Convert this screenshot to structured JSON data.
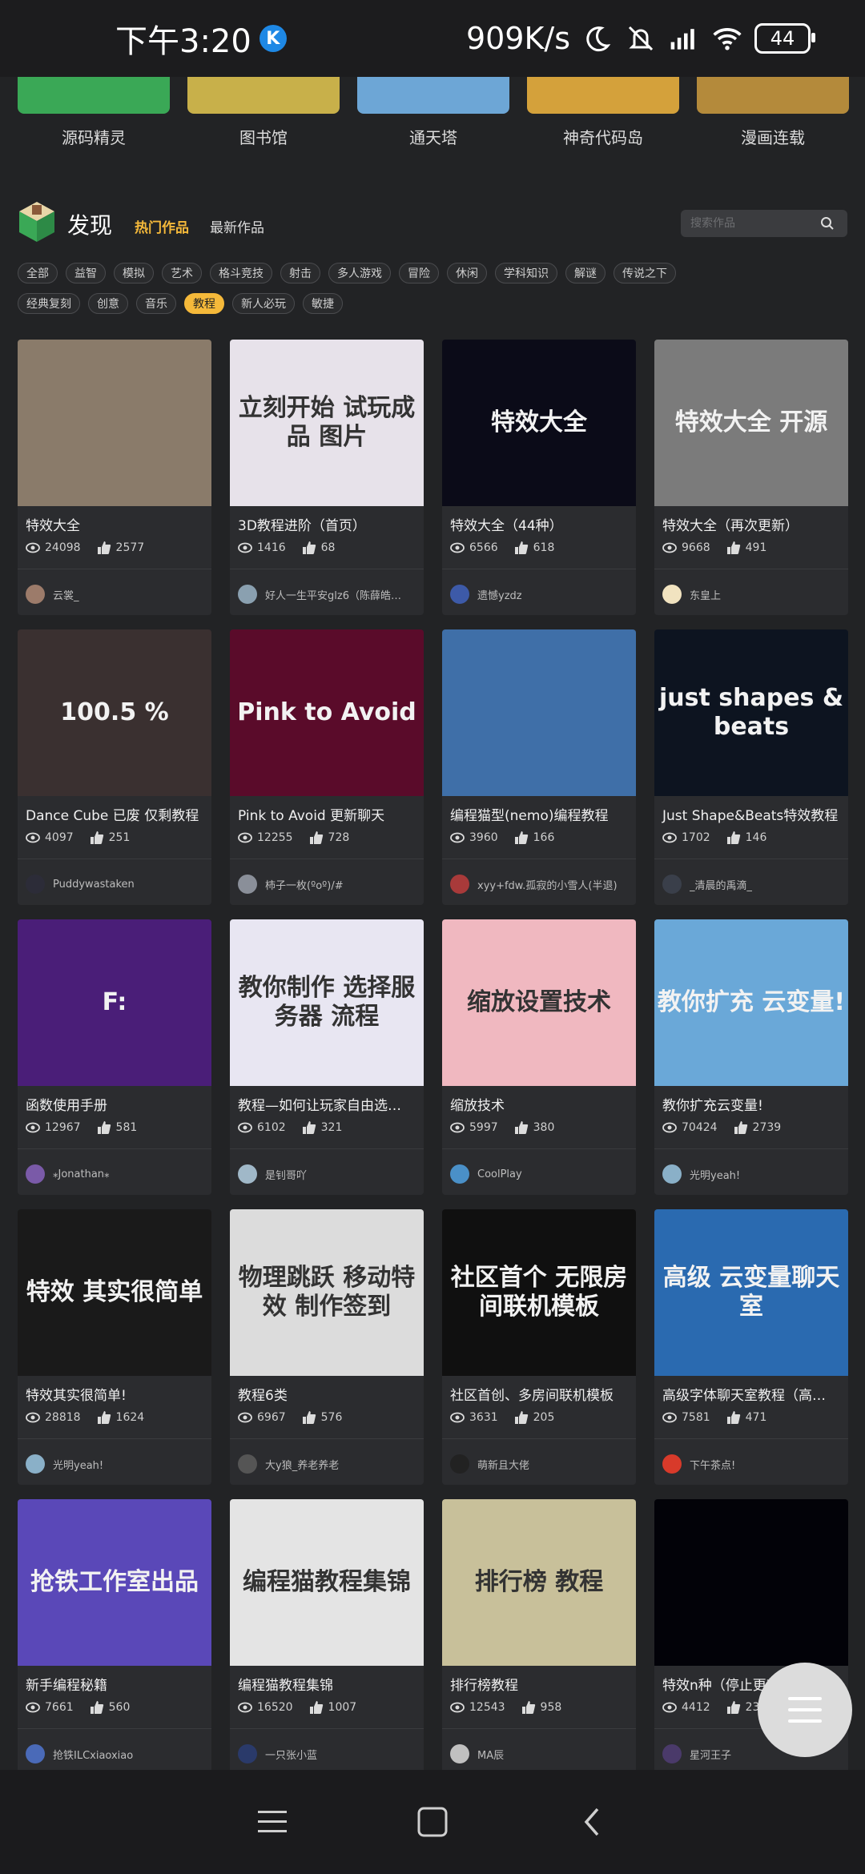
{
  "status_bar": {
    "time": "下午3:20",
    "badge": "K",
    "net_speed": "909K/s",
    "battery": "44"
  },
  "categories": [
    {
      "label": "源码精灵",
      "color": "#3aa856"
    },
    {
      "label": "图书馆",
      "color": "#c8b04a"
    },
    {
      "label": "通天塔",
      "color": "#6da6d6"
    },
    {
      "label": "神奇代码岛",
      "color": "#d4a13b"
    },
    {
      "label": "漫画连载",
      "color": "#b48a3b"
    }
  ],
  "discover": {
    "title": "发现",
    "tab_hot": "热门作品",
    "tab_new": "最新作品",
    "search_placeholder": "搜索作品"
  },
  "tags_row1": [
    "全部",
    "益智",
    "模拟",
    "艺术",
    "格斗竞技",
    "射击",
    "多人游戏",
    "冒险",
    "休闲",
    "学科知识",
    "解谜",
    "传说之下"
  ],
  "tags_row2": [
    "经典复刻",
    "创意",
    "音乐",
    "教程",
    "新人必玩",
    "敏捷"
  ],
  "active_tag": "教程",
  "works": [
    {
      "title": "特效大全",
      "views": "24098",
      "likes": "2577",
      "author": "云裳_",
      "thumb_bg": "#8a7b6a",
      "thumb_text": "",
      "avatar": "#9c7b6a"
    },
    {
      "title": "3D教程进阶（首页）",
      "views": "1416",
      "likes": "68",
      "author": "好人一生平安glz6（陈薛皓…",
      "thumb_bg": "#e7e2ea",
      "thumb_text": "立刻开始 试玩成品 图片",
      "avatar": "#8aa0b0"
    },
    {
      "title": "特效大全（44种）",
      "views": "6566",
      "likes": "618",
      "author": "遗憾yzdz",
      "thumb_bg": "#0b0b18",
      "thumb_text": "特效大全",
      "avatar": "#3d5aa8"
    },
    {
      "title": "特效大全（再次更新）",
      "views": "9668",
      "likes": "491",
      "author": "东皇上",
      "thumb_bg": "#7b7b7b",
      "thumb_text": "特效大全 开源",
      "avatar": "#f1e3c0"
    },
    {
      "title": "Dance Cube 已废 仅剩教程",
      "views": "4097",
      "likes": "251",
      "author": "Puddywastaken",
      "thumb_bg": "#3a3030",
      "thumb_text": "100.5 %",
      "avatar": "#2c2c38"
    },
    {
      "title": "Pink to Avoid 更新聊天",
      "views": "12255",
      "likes": "728",
      "author": "柿子一枚(ºoº)/#",
      "thumb_bg": "#5a0b2a",
      "thumb_text": "Pink to Avoid",
      "avatar": "#8a8f99"
    },
    {
      "title": "编程猫型(nemo)编程教程",
      "views": "3960",
      "likes": "166",
      "author": "xyy+fdw.孤寂的小雪人(半退)",
      "thumb_bg": "#3f6fa8",
      "thumb_text": "",
      "avatar": "#a83a3a"
    },
    {
      "title": "Just Shape&Beats特效教程",
      "views": "1702",
      "likes": "146",
      "author": "_清晨的禹滴_",
      "thumb_bg": "#0d1420",
      "thumb_text": "just shapes & beats",
      "avatar": "#3a3f4a"
    },
    {
      "title": "函数使用手册",
      "views": "12967",
      "likes": "581",
      "author": "⁎Jonathan⁎",
      "thumb_bg": "#4a1e78",
      "thumb_text": "F:",
      "avatar": "#7a5aa8"
    },
    {
      "title": "教程—如何让玩家自由选…",
      "views": "6102",
      "likes": "321",
      "author": "是钊哥吖",
      "thumb_bg": "#e8e6f2",
      "thumb_text": "教你制作 选择服务器 流程",
      "avatar": "#a0b8c8"
    },
    {
      "title": "缩放技术",
      "views": "5997",
      "likes": "380",
      "author": "CoolPlay",
      "thumb_bg": "#f0b8c0",
      "thumb_text": "缩放设置技术",
      "avatar": "#4a90c8"
    },
    {
      "title": "教你扩充云变量!",
      "views": "70424",
      "likes": "2739",
      "author": "光明yeah!",
      "thumb_bg": "#6aa8d8",
      "thumb_text": "教你扩充 云变量!",
      "avatar": "#8ab0c8"
    },
    {
      "title": "特效其实很简单!",
      "views": "28818",
      "likes": "1624",
      "author": "光明yeah!",
      "thumb_bg": "#1a1a1a",
      "thumb_text": "特效 其实很简单",
      "avatar": "#8ab0c8"
    },
    {
      "title": "教程6类",
      "views": "6967",
      "likes": "576",
      "author": "大y狼_养老养老",
      "thumb_bg": "#dcdcdc",
      "thumb_text": "物理跳跃 移动特效 制作签到",
      "avatar": "#555"
    },
    {
      "title": "社区首创、多房间联机模板",
      "views": "3631",
      "likes": "205",
      "author": "萌新且大佬",
      "thumb_bg": "#101010",
      "thumb_text": "社区首个 无限房间联机模板",
      "avatar": "#222"
    },
    {
      "title": "高级字体聊天室教程（高…",
      "views": "7581",
      "likes": "471",
      "author": "下午茶点!",
      "thumb_bg": "#2a6ab0",
      "thumb_text": "高级 云变量聊天室",
      "avatar": "#d83a2a"
    },
    {
      "title": "新手编程秘籍",
      "views": "7661",
      "likes": "560",
      "author": "抢铁ILCxiaoxiao",
      "thumb_bg": "#5a48b8",
      "thumb_text": "抢铁工作室出品",
      "avatar": "#4a6ab8"
    },
    {
      "title": "编程猫教程集锦",
      "views": "16520",
      "likes": "1007",
      "author": "一只张小蓝",
      "thumb_bg": "#e4e4e4",
      "thumb_text": "编程猫教程集锦",
      "avatar": "#2a3a6a"
    },
    {
      "title": "排行榜教程",
      "views": "12543",
      "likes": "958",
      "author": "MA辰",
      "thumb_bg": "#c8c09a",
      "thumb_text": "排行榜 教程",
      "avatar": "#c0c0c0"
    },
    {
      "title": "特效n种（停止更新）",
      "views": "4412",
      "likes": "232",
      "author": "星河王子",
      "thumb_bg": "#020208",
      "thumb_text": "",
      "avatar": "#4a3a6a"
    }
  ],
  "nav": {
    "menu_icon": "menu-icon",
    "home_icon": "home-square-icon",
    "back_icon": "back-chevron-icon"
  }
}
